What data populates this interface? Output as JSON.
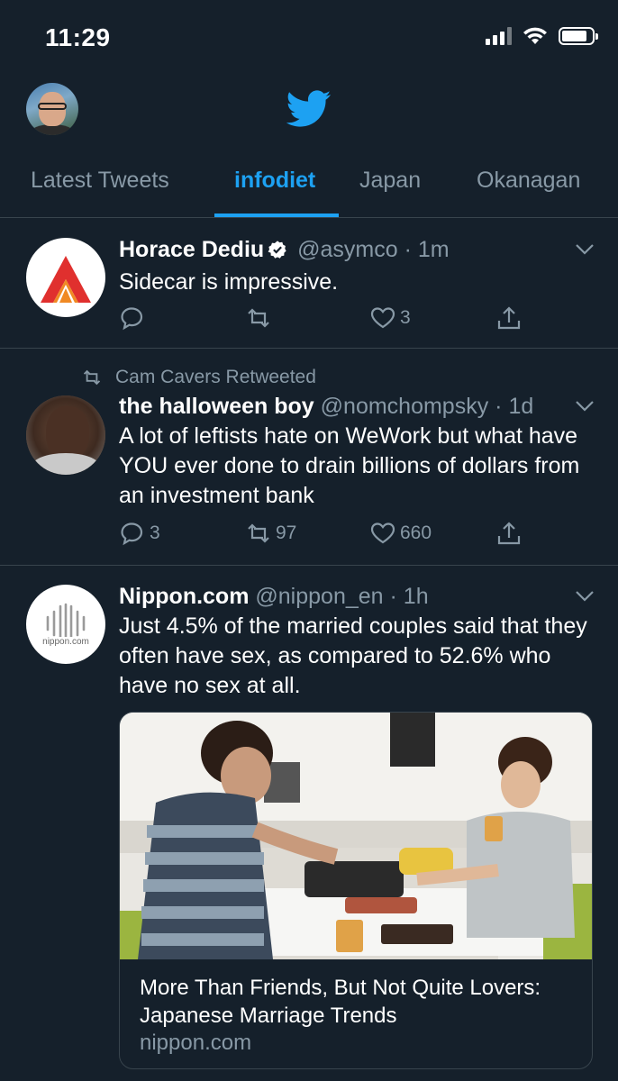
{
  "status": {
    "time": "11:29",
    "battery_level": 0.85
  },
  "tabs": [
    {
      "label": "Latest Tweets",
      "active": false
    },
    {
      "label": "infodiet",
      "active": true
    },
    {
      "label": "Japan",
      "active": false
    },
    {
      "label": "Okanagan",
      "active": false
    }
  ],
  "colors": {
    "background": "#15202b",
    "accent": "#1da1f2",
    "muted": "#8899a6",
    "divider": "#38444d"
  },
  "tweets": [
    {
      "name": "Horace Dediu",
      "verified": true,
      "handle": "@asymco",
      "time": "1m",
      "text": "Sidecar is impressive.",
      "replies": "",
      "retweets": "",
      "likes": "3"
    },
    {
      "retweeted_by": "Cam Cavers Retweeted",
      "name": "the halloween boy",
      "handle": "@nomchompsky",
      "time": "1d",
      "text": "A lot of leftists hate on WeWork but what have YOU ever done to drain billions of dollars from an investment bank",
      "replies": "3",
      "retweets": "97",
      "likes": "660"
    },
    {
      "name": "Nippon.com",
      "handle": "@nippon_en",
      "time": "1h",
      "text": "Just 4.5% of the married couples said that they often have sex, as compared to 52.6% who have no sex at all.",
      "avatar_text": "nippon.com",
      "card": {
        "title": "More Than Friends, But Not Quite Lovers: Japanese Marriage Trends",
        "domain": "nippon.com"
      }
    }
  ],
  "separator": "·"
}
